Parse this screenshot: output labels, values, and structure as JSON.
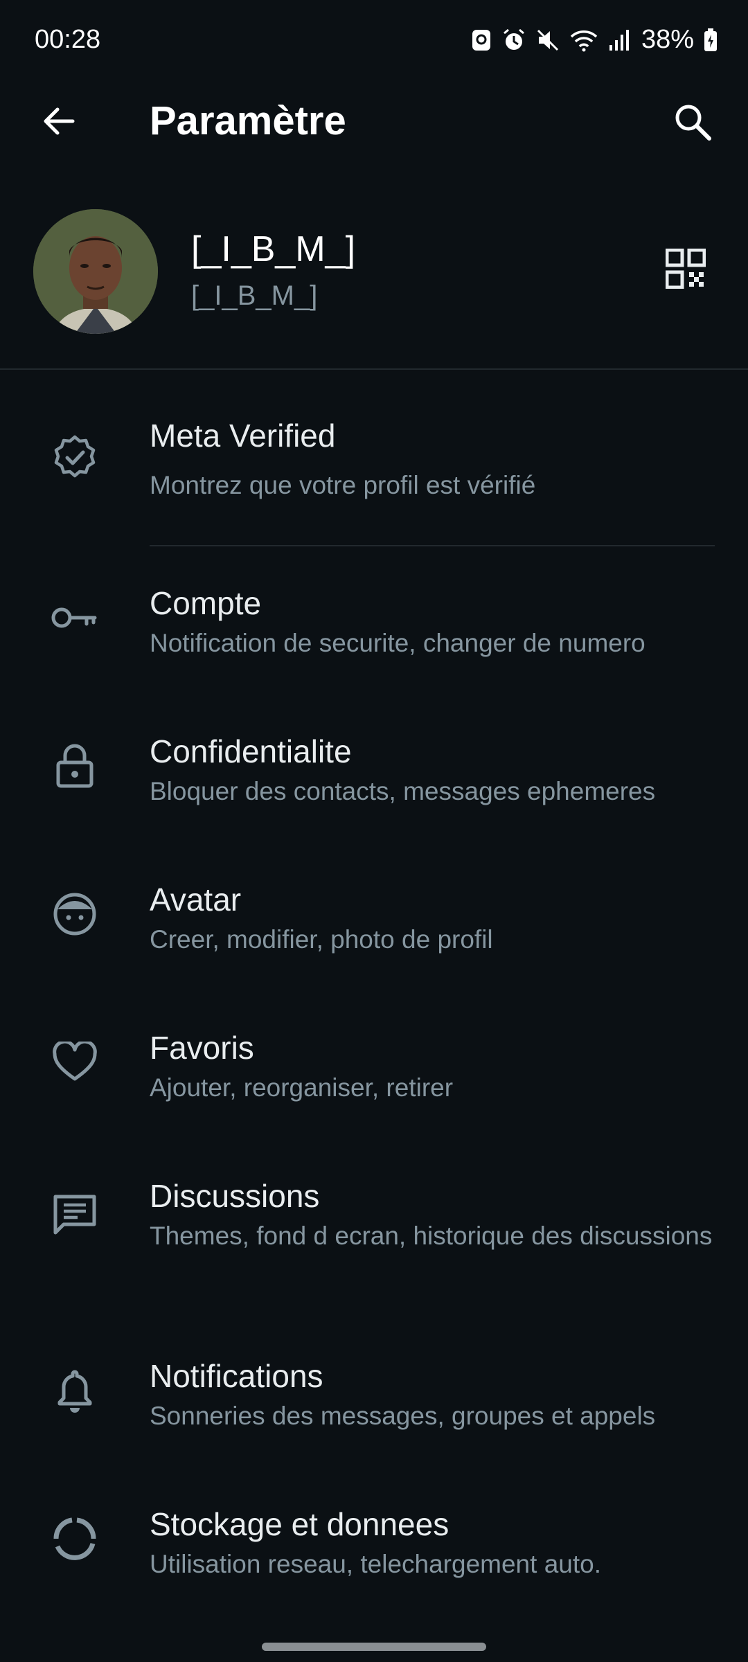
{
  "status_bar": {
    "time": "00:28",
    "battery": "38%",
    "icons": [
      "vpn-icon",
      "alarm-icon",
      "mute-icon",
      "wifi-icon",
      "signal-icon",
      "battery-charging-icon"
    ]
  },
  "app_bar": {
    "title": "Paramètre",
    "back_icon": "arrow-left-icon",
    "search_icon": "search-icon"
  },
  "profile": {
    "name": "[_I_B_M_]",
    "about": "[_I_B_M_]",
    "qr_icon": "qr-code-icon"
  },
  "settings": [
    {
      "icon": "verified-badge-icon",
      "title": "Meta Verified",
      "subtitle": "Montrez que votre profil est vérifié"
    },
    {
      "icon": "key-icon",
      "title": "Compte",
      "subtitle": "Notification de securite, changer de numero"
    },
    {
      "icon": "lock-icon",
      "title": "Confidentialite",
      "subtitle": "Bloquer des contacts, messages ephemeres"
    },
    {
      "icon": "avatar-face-icon",
      "title": "Avatar",
      "subtitle": "Creer, modifier, photo de profil"
    },
    {
      "icon": "heart-icon",
      "title": "Favoris",
      "subtitle": "Ajouter, reorganiser, retirer"
    },
    {
      "icon": "chat-icon",
      "title": "Discussions",
      "subtitle": "Themes, fond d ecran, historique des discussions"
    },
    {
      "icon": "bell-icon",
      "title": "Notifications",
      "subtitle": "Sonneries des messages, groupes et appels"
    },
    {
      "icon": "storage-icon",
      "title": "Stockage et donnees",
      "subtitle": "Utilisation reseau, telechargement auto."
    }
  ],
  "colors": {
    "background": "#0b1014",
    "primary_text": "#e9edef",
    "secondary_text": "#8696a0",
    "icon": "#8696a0",
    "divider": "#22292e"
  }
}
